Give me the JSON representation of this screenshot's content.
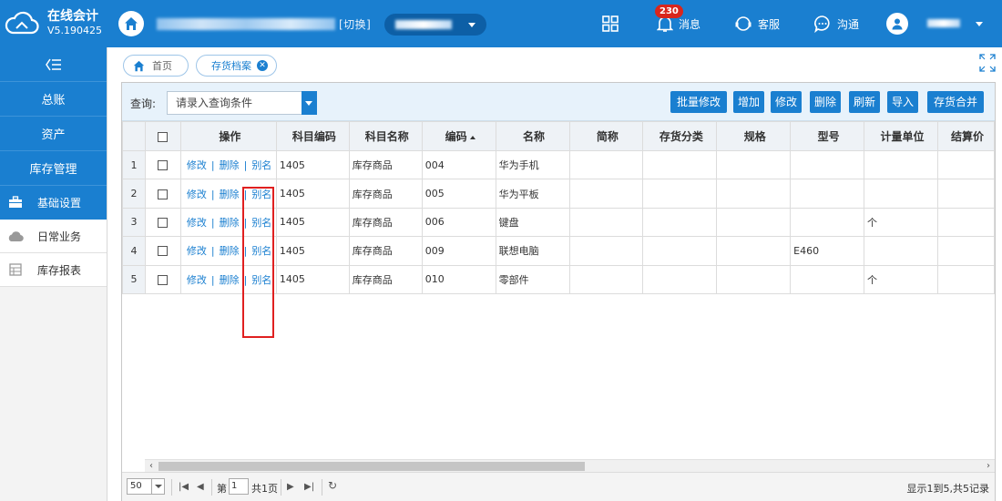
{
  "app": {
    "name": "在线会计",
    "version": "V5.190425"
  },
  "header": {
    "company_suffix": "[切换]",
    "messages_label": "消息",
    "messages_badge": "230",
    "service_label": "客服",
    "chat_label": "沟通"
  },
  "sidebar": {
    "main": [
      "总账",
      "资产",
      "库存管理"
    ],
    "sub": [
      {
        "label": "基础设置",
        "icon": "briefcase-icon",
        "active": true
      },
      {
        "label": "日常业务",
        "icon": "cloud-icon",
        "active": false
      },
      {
        "label": "库存报表",
        "icon": "report-icon",
        "active": false
      }
    ]
  },
  "tabs": {
    "home": "首页",
    "current": "存货档案"
  },
  "toolbar": {
    "query_label": "查询:",
    "query_placeholder": "请录入查询条件",
    "buttons": [
      "批量修改",
      "增加",
      "修改",
      "删除",
      "刷新",
      "导入",
      "存货合并"
    ]
  },
  "table": {
    "columns": [
      "操作",
      "科目编码",
      "科目名称",
      "编码",
      "名称",
      "简称",
      "存货分类",
      "规格",
      "型号",
      "计量单位",
      "结算价"
    ],
    "actions": {
      "edit": "修改",
      "delete": "删除",
      "alias": "别名"
    },
    "rows": [
      {
        "no": "1",
        "subject_code": "1405",
        "subject_name": "库存商品",
        "code": "004",
        "name": "华为手机",
        "abbr": "",
        "category": "",
        "spec": "",
        "model": "",
        "unit": "",
        "price": ""
      },
      {
        "no": "2",
        "subject_code": "1405",
        "subject_name": "库存商品",
        "code": "005",
        "name": "华为平板",
        "abbr": "",
        "category": "",
        "spec": "",
        "model": "",
        "unit": "",
        "price": ""
      },
      {
        "no": "3",
        "subject_code": "1405",
        "subject_name": "库存商品",
        "code": "006",
        "name": "键盘",
        "abbr": "",
        "category": "",
        "spec": "",
        "model": "",
        "unit": "个",
        "price": ""
      },
      {
        "no": "4",
        "subject_code": "1405",
        "subject_name": "库存商品",
        "code": "009",
        "name": "联想电脑",
        "abbr": "",
        "category": "",
        "spec": "",
        "model": "E460",
        "unit": "",
        "price": ""
      },
      {
        "no": "5",
        "subject_code": "1405",
        "subject_name": "库存商品",
        "code": "010",
        "name": "零部件",
        "abbr": "",
        "category": "",
        "spec": "",
        "model": "",
        "unit": "个",
        "price": ""
      }
    ]
  },
  "pager": {
    "page_size": "50",
    "page_prefix": "第",
    "current_page": "1",
    "total_pages": "共1页",
    "info": "显示1到5,共5记录"
  },
  "colors": {
    "primary": "#1a7fd0",
    "highlight_box": "#e02020",
    "badge": "#d9261c"
  }
}
